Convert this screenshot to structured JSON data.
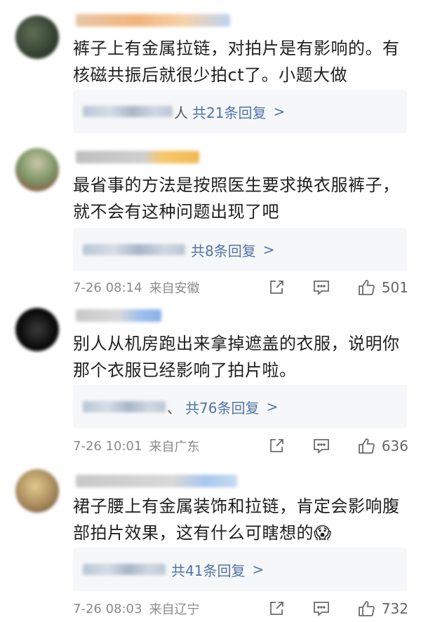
{
  "comments": [
    {
      "avatar_color": "#3d4a35",
      "name_color": "#f0b57a",
      "text": "裤子上有金属拉链，对拍片是有影响的。有核磁共振后就很少拍ct了。小题大做",
      "replies_tail": "人",
      "replies_count": "共21条回复",
      "time": "",
      "location": "",
      "likes": ""
    },
    {
      "avatar_color": "#7f9a6a",
      "name_color": "#f3c46a",
      "text": "最省事的方法是按照医生要求换衣服裤子，就不会有这种问题出现了吧",
      "replies_tail": "",
      "replies_count": "共8条回复",
      "time": "7-26 08:14",
      "location": "来自安徽",
      "likes": "501"
    },
    {
      "avatar_color": "#111111",
      "name_color": "#a9c7ee",
      "text": "别人从机房跑出来拿掉遮盖的衣服，说明你那个衣服已经影响了拍片啦。",
      "replies_tail": "、",
      "replies_count": "共76条回复",
      "time": "7-26 10:01",
      "location": "来自广东",
      "likes": "636"
    },
    {
      "avatar_color": "#b59a6a",
      "name_color": "#b8d3f0",
      "text": "裙子腰上有金属装饰和拉链，肯定会影响腹部拍片效果，这有什么可瞎想的😱",
      "replies_tail": "",
      "replies_count": "共41条回复",
      "time": "7-26 08:03",
      "location": "来自辽宁",
      "likes": "732"
    }
  ],
  "icons": {
    "reply_chevron": ">",
    "share": "share-icon",
    "comment": "comment-icon",
    "like": "thumbs-up-icon"
  }
}
